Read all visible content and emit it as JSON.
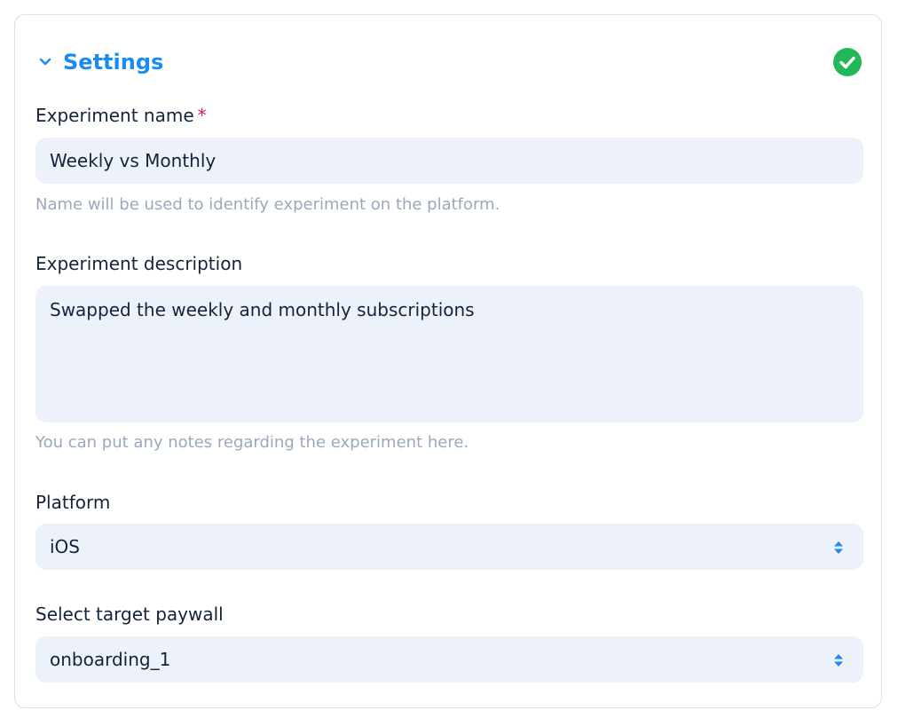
{
  "section": {
    "title": "Settings",
    "status_icon": "check-circle-icon",
    "collapse_icon": "chevron-down-icon"
  },
  "experiment_name": {
    "label": "Experiment name",
    "required_marker": "*",
    "value": "Weekly vs Monthly",
    "hint": "Name will be used to identify experiment on the platform."
  },
  "experiment_description": {
    "label": "Experiment description",
    "value": "Swapped the weekly and monthly subscriptions",
    "hint": "You can put any notes regarding the experiment here."
  },
  "platform": {
    "label": "Platform",
    "selected": "iOS",
    "icon": "select-arrows-icon"
  },
  "target_paywall": {
    "label": "Select target paywall",
    "selected": "onboarding_1",
    "icon": "select-arrows-icon"
  },
  "colors": {
    "accent": "#1a8bf0",
    "success": "#22b858",
    "required": "#e5174f",
    "field_bg": "#edf1f9"
  }
}
